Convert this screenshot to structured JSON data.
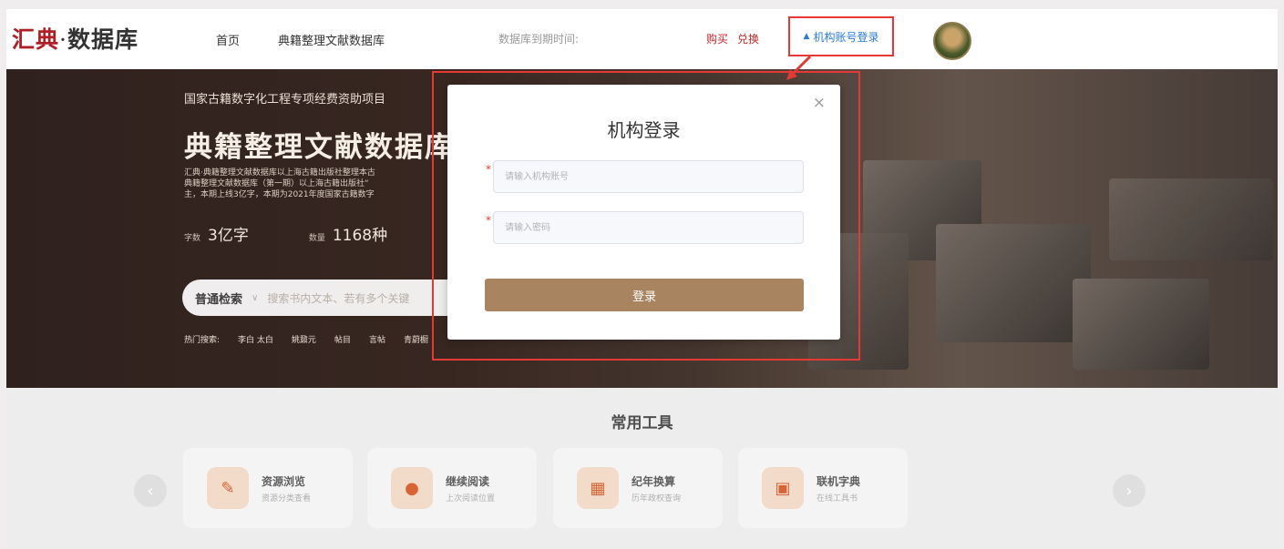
{
  "header": {
    "logo_main": "汇典",
    "logo_dot": "·",
    "logo_rest": "数据库",
    "nav_home": "首页",
    "nav_db": "典籍整理文献数据库",
    "expire_label": "数据库到期时间:",
    "buy_label": "购买",
    "redeem_label": "兑换",
    "institution_login": "机构账号登录"
  },
  "hero": {
    "subtitle": "国家古籍数字化工程专项经费资助项目",
    "title": "典籍整理文献数据库",
    "desc_line1": "汇典·典籍整理文献数据库以上海古籍出版社整理本古",
    "desc_line2": "典籍整理文献数据库（第一期）以上海古籍出版社“",
    "desc_line3": "主，本期上线3亿字，本期为2021年度国家古籍数字",
    "stat1_label": "字数",
    "stat1_value": "3亿字",
    "stat2_label": "数量",
    "stat2_value": "1168种",
    "search_mode": "普通检索",
    "search_placeholder": "搜索书内文本、若有多个关键",
    "hot_label": "热门搜索:",
    "hot_items": [
      "李白 太白",
      "姚鼐元",
      "帖目",
      "言帖",
      "青蔚橱"
    ]
  },
  "tools": {
    "title": "常用工具",
    "cards": [
      {
        "title": "资源浏览",
        "sub": "资源分类查看",
        "icon": "pen-icon"
      },
      {
        "title": "继续阅读",
        "sub": "上次阅读位置",
        "icon": "palette-icon"
      },
      {
        "title": "纪年换算",
        "sub": "历年政权查询",
        "icon": "calendar-icon"
      },
      {
        "title": "联机字典",
        "sub": "在线工具书",
        "icon": "book-icon"
      }
    ]
  },
  "modal": {
    "title": "机构登录",
    "account_placeholder": "请输入机构账号",
    "password_placeholder": "请输入密码",
    "login_button": "登录",
    "close": "×",
    "required_mark": "*"
  },
  "colors": {
    "brand_red": "#b01f24",
    "login_button": "#a88560",
    "annotation_red": "#e53935",
    "link_blue": "#2a7bd6"
  }
}
